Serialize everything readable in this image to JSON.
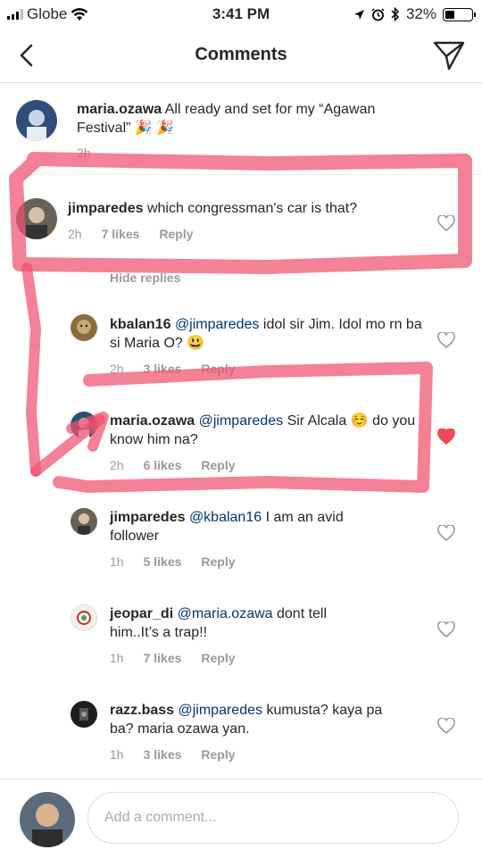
{
  "status_bar": {
    "carrier": "Globe",
    "time": "3:41 PM",
    "battery": "32%"
  },
  "header": {
    "title": "Comments"
  },
  "caption": {
    "username": "maria.ozawa",
    "text": "All ready and set for my “Agawan Festival” 🎉 🎉",
    "time": "2h"
  },
  "comments": [
    {
      "username": "jimparedes",
      "mention": "",
      "text": "which congressman's car is that?",
      "time": "2h",
      "likes": "7 likes",
      "reply": "Reply",
      "liked": false
    }
  ],
  "hide_replies": "Hide replies",
  "replies": [
    {
      "username": "kbalan16",
      "mention": "@jimparedes",
      "text": "idol sir Jim. Idol mo rn ba si Maria O? 😃",
      "time": "2h",
      "likes": "3 likes",
      "reply": "Reply",
      "liked": false
    },
    {
      "username": "maria.ozawa",
      "mention": "@jimparedes",
      "text": "Sir Alcala ☺️ do you know him na?",
      "time": "2h",
      "likes": "6 likes",
      "reply": "Reply",
      "liked": true
    },
    {
      "username": "jimparedes",
      "mention": "@kbalan16",
      "text": "I am an avid follower",
      "time": "1h",
      "likes": "5 likes",
      "reply": "Reply",
      "liked": false
    },
    {
      "username": "jeopar_di",
      "mention": "@maria.ozawa",
      "text": "dont tell him..It’s a trap!!",
      "time": "1h",
      "likes": "7 likes",
      "reply": "Reply",
      "liked": false
    },
    {
      "username": "razz.bass",
      "mention": "@jimparedes",
      "text": "kumusta? kaya pa ba? maria ozawa yan.",
      "time": "1h",
      "likes": "3 likes",
      "reply": "Reply",
      "liked": false
    }
  ],
  "composer": {
    "placeholder": "Add a comment..."
  },
  "colors": {
    "liked_heart": "#ed4956",
    "marker": "#f0506e",
    "mention": "#003569"
  }
}
